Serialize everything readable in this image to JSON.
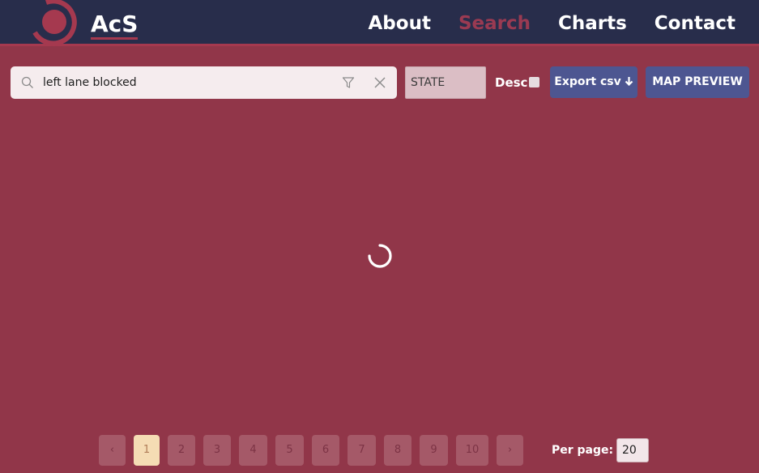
{
  "header": {
    "brand": "AcS",
    "nav": [
      {
        "label": "About"
      },
      {
        "label": "Search"
      },
      {
        "label": "Charts"
      },
      {
        "label": "Contact"
      }
    ],
    "active_nav": "Search"
  },
  "search": {
    "query": "left lane blocked",
    "placeholder": ""
  },
  "sort": {
    "field": "STATE",
    "desc_label": "Desc",
    "desc_checked": false
  },
  "actions": {
    "export_label": "Export csv",
    "export_arrow": "🡓",
    "map_label": "MAP PREVIEW"
  },
  "pagination": {
    "prev": "‹",
    "next": "›",
    "pages": [
      "1",
      "2",
      "3",
      "4",
      "5",
      "6",
      "7",
      "8",
      "9",
      "10"
    ],
    "current": "1",
    "per_page_label": "Per page:",
    "per_page": "20"
  },
  "colors": {
    "background": "#913649",
    "navbar": "#282d4b",
    "accent": "#a5394f",
    "button": "#4d5691",
    "active_page": "#f5dcb4"
  },
  "icons": [
    "logo-icon",
    "search-icon",
    "filter-icon",
    "close-icon",
    "arrow-down-icon",
    "loading-spinner-icon"
  ]
}
